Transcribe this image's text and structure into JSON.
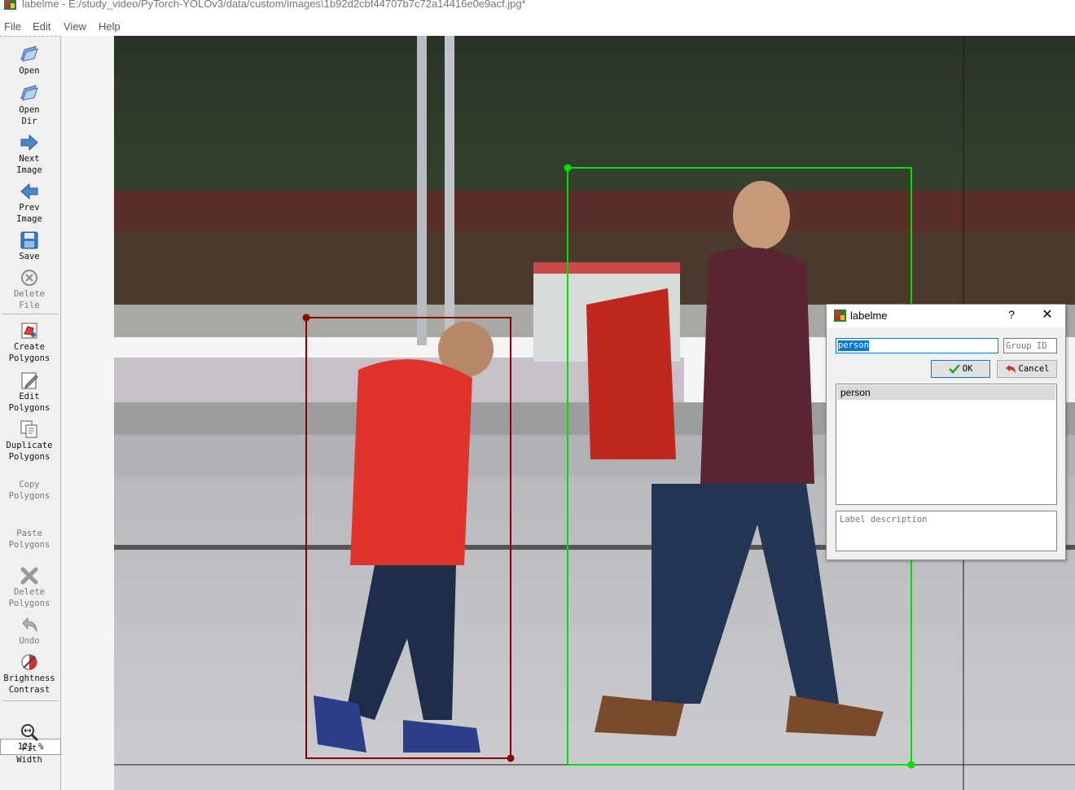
{
  "window": {
    "title": "labelme - E:/study_video/PyTorch-YOLOv3/data/custom/images\\1b92d2cbf44707b7c72a14416e0e9acf.jpg*"
  },
  "menu": [
    "File",
    "Edit",
    "View",
    "Help"
  ],
  "toolbar": {
    "tools": [
      {
        "label": "Open",
        "icon": "folder-open-icon",
        "enabled": true
      },
      {
        "label": "Open\nDir",
        "icon": "folder-open-icon",
        "enabled": true
      },
      {
        "label": "Next\nImage",
        "icon": "arrow-right-icon",
        "enabled": true
      },
      {
        "label": "Prev\nImage",
        "icon": "arrow-left-icon",
        "enabled": true
      },
      {
        "label": "Save",
        "icon": "floppy-disk-icon",
        "enabled": true
      },
      {
        "label": "Delete\nFile",
        "icon": "delete-circle-icon",
        "enabled": false
      },
      {
        "label": "Create\nPolygons",
        "icon": "create-polygon-icon",
        "enabled": true
      },
      {
        "label": "Edit\nPolygons",
        "icon": "edit-icon",
        "enabled": true
      },
      {
        "label": "Duplicate\nPolygons",
        "icon": "duplicate-icon",
        "enabled": true
      },
      {
        "label": "Copy\nPolygons",
        "icon": "",
        "enabled": false
      },
      {
        "label": "Paste\nPolygons",
        "icon": "",
        "enabled": false
      },
      {
        "label": "Delete\nPolygons",
        "icon": "delete-x-icon",
        "enabled": false
      },
      {
        "label": "Undo",
        "icon": "undo-icon",
        "enabled": false
      },
      {
        "label": "Brightness\nContrast",
        "icon": "brightness-icon",
        "enabled": true
      },
      {
        "label": "Fit\nWidth",
        "icon": "fit-width-icon",
        "enabled": true
      }
    ],
    "zoom": "121 %"
  },
  "canvas": {
    "shapes": [
      {
        "label": "person",
        "color": "#8b0000"
      },
      {
        "label": "person",
        "color": "#00e000"
      }
    ]
  },
  "dialog": {
    "title": "labelme",
    "help": "?",
    "close": "✕",
    "label_value": "person",
    "group_id_placeholder": "Group ID",
    "ok_label": "OK",
    "cancel_label": "Cancel",
    "label_list": [
      "person"
    ],
    "description_placeholder": "Label description"
  },
  "colors": {
    "selection": "#0078d7",
    "box_selected": "#00e000",
    "box_other": "#8b0000"
  }
}
